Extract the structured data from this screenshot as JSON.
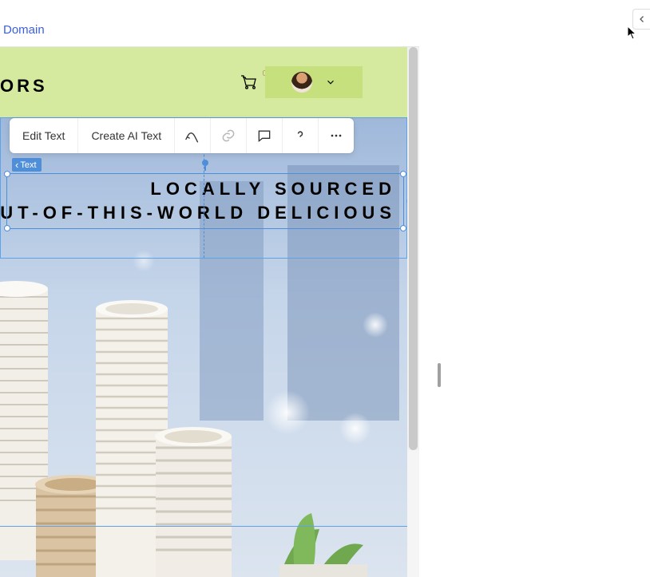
{
  "topbar": {
    "domain_link": "Domain"
  },
  "header": {
    "logo_fragment": "ORS",
    "cart_count": "0"
  },
  "selection": {
    "badge_label": "Text"
  },
  "hero": {
    "line1": "Locally Sourced",
    "line2": "Out-of-this-world delicious"
  },
  "toolbar": {
    "edit_text": "Edit Text",
    "create_ai_text": "Create AI Text"
  },
  "icons": {
    "animation": "animation-icon",
    "link": "link-icon",
    "comment": "comment-icon",
    "help": "help-icon",
    "more": "more-icon",
    "cart": "cart-icon",
    "chevron_down": "chevron-down-icon",
    "chevron_left": "chevron-left-icon"
  }
}
